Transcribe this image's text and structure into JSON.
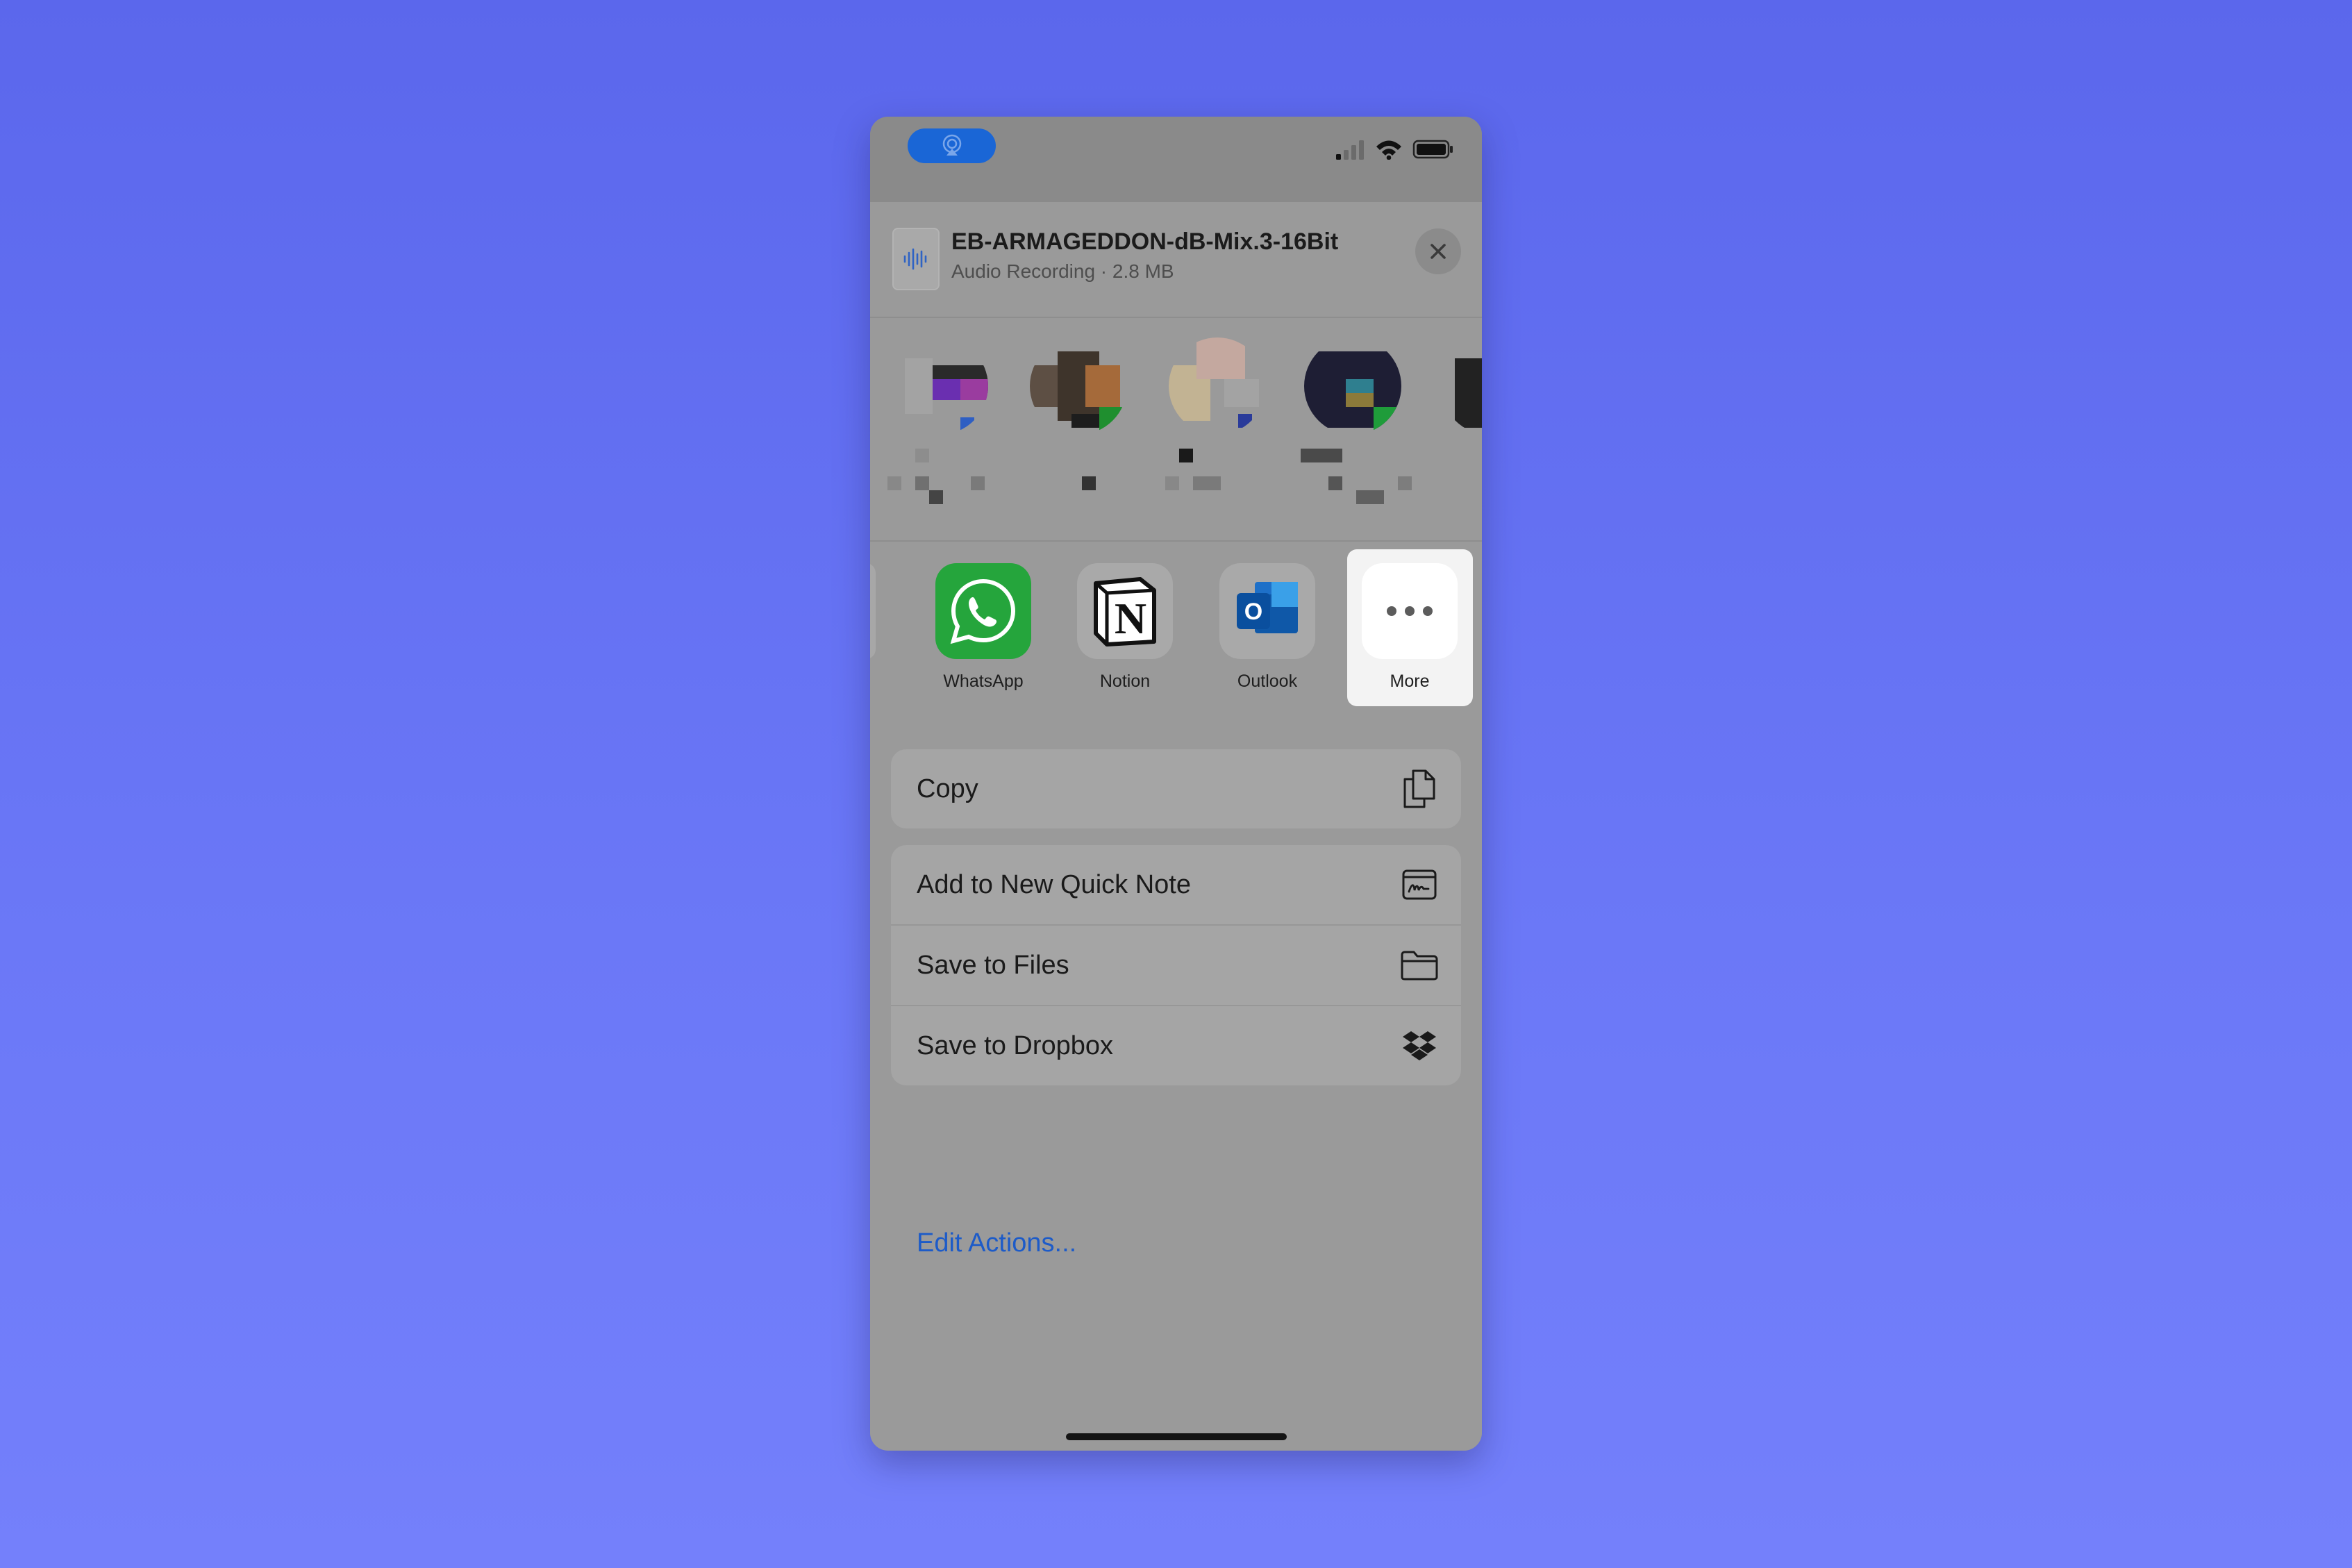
{
  "status_bar": {
    "pill_icon": "airplay-audio-icon",
    "signal_icon": "cellular-signal-icon",
    "wifi_icon": "wifi-icon",
    "battery_icon": "battery-icon"
  },
  "file": {
    "icon": "audio-file-icon",
    "title": "EB-ARMAGEDDON-dB-Mix.3-16Bit",
    "subtitle": "Audio Recording · 2.8 MB",
    "close_icon": "close-icon"
  },
  "people": [
    {
      "icon": "contact-avatar-icon"
    },
    {
      "icon": "contact-avatar-icon"
    },
    {
      "icon": "contact-avatar-icon"
    },
    {
      "icon": "contact-avatar-icon"
    },
    {
      "icon": "contact-avatar-icon"
    }
  ],
  "apps": [
    {
      "label": "WhatsApp",
      "icon": "whatsapp-icon",
      "color": "#25a53c"
    },
    {
      "label": "Notion",
      "icon": "notion-icon",
      "color": "#ffffff"
    },
    {
      "label": "Outlook",
      "icon": "outlook-icon",
      "color": "#0a64c9"
    },
    {
      "label": "More",
      "icon": "more-ellipsis-icon",
      "color": "#ffffff"
    }
  ],
  "actions": {
    "copy": {
      "label": "Copy",
      "icon": "copy-icon"
    },
    "quick_note": {
      "label": "Add to New Quick Note",
      "icon": "quick-note-icon"
    },
    "save_files": {
      "label": "Save to Files",
      "icon": "folder-icon"
    },
    "save_dropbox": {
      "label": "Save to Dropbox",
      "icon": "dropbox-icon"
    }
  },
  "edit_actions_label": "Edit Actions..."
}
